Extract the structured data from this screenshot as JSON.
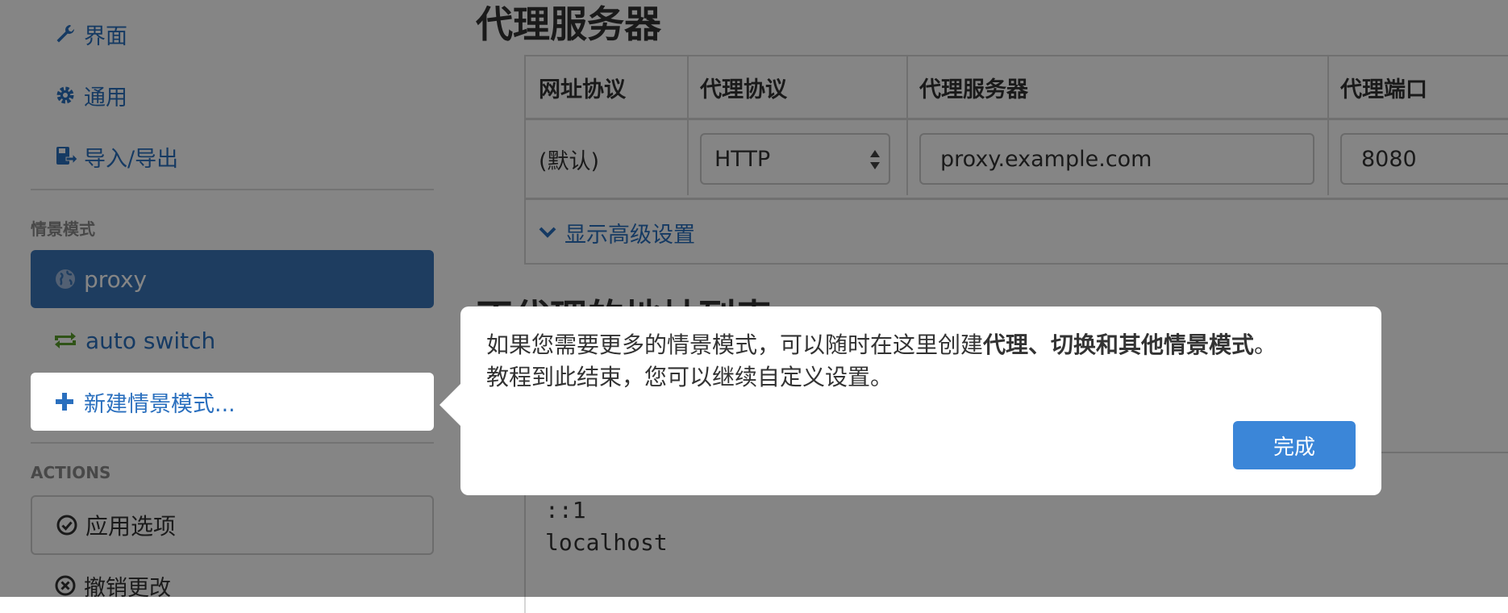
{
  "sidebar": {
    "settings_items": [
      {
        "label": "界面",
        "icon": "wrench-icon"
      },
      {
        "label": "通用",
        "icon": "gear-icon"
      },
      {
        "label": "导入/导出",
        "icon": "import-export-icon"
      }
    ],
    "profiles_header": "情景模式",
    "profiles": [
      {
        "label": "proxy",
        "icon": "globe-icon",
        "active": true
      },
      {
        "label": "auto switch",
        "icon": "switch-arrows-icon",
        "active": false
      }
    ],
    "new_profile_label": "新建情景模式...",
    "actions_header": "ACTIONS",
    "apply_label": "应用选项",
    "discard_label": "撤销更改"
  },
  "main": {
    "title": "代理服务器",
    "table": {
      "headers": [
        "网址协议",
        "代理协议",
        "代理服务器",
        "代理端口"
      ],
      "row": {
        "scheme": "(默认)",
        "protocol": "HTTP",
        "server": "proxy.example.com",
        "port": "8080"
      }
    },
    "advanced_label": "显示高级设置",
    "bypass_title": "不代理的地址列表",
    "bypass_list": [
      "::1",
      "localhost"
    ]
  },
  "popover": {
    "text_part1": "如果您需要更多的情景模式，可以随时在这里创建",
    "text_bold": "代理、切换和其他情景模式",
    "text_part2": "。",
    "text_line2": "教程到此结束，您可以继续自定义设置。",
    "done_label": "完成"
  },
  "colors": {
    "accent": "#2a6fbe",
    "active_profile_bg": "#3a76b8",
    "primary_button": "#3b86d8",
    "overlay": "rgba(0,0,0,0.48)"
  }
}
